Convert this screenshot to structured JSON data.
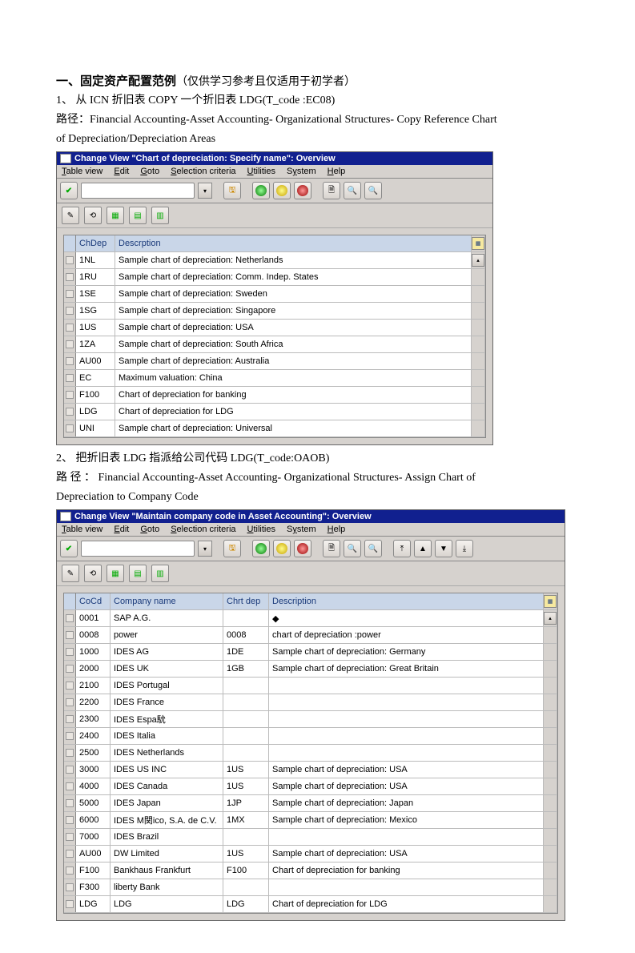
{
  "doc": {
    "title_bold": "一、固定资产配置范例",
    "title_paren": "（仅供学习参考且仅适用于初学者）",
    "step1": "1、 从 ICN 折旧表 COPY 一个折旧表 LDG(T_code :EC08)",
    "path1a": "路径：Financial Accounting-Asset Accounting- Organizational Structures- Copy Reference Chart",
    "path1b": "of Depreciation/Depreciation Areas",
    "step2": "2、 把折旧表 LDG 指派给公司代码 LDG(T_code:OAOB)",
    "path2a": "路 径 ： Financial Accounting-Asset Accounting- Organizational Structures- Assign Chart of",
    "path2b": "Depreciation to Company Code"
  },
  "sap1": {
    "title": "Change View \"Chart of depreciation: Specify name\": Overview",
    "menu": [
      "Table view",
      "Edit",
      "Goto",
      "Selection criteria",
      "Utilities",
      "System",
      "Help"
    ],
    "cols": {
      "code": "ChDep",
      "desc": "Descrption"
    },
    "rows": [
      {
        "code": "1NL",
        "desc": "Sample chart of depreciation: Netherlands"
      },
      {
        "code": "1RU",
        "desc": "Sample chart of depreciation: Comm. Indep. States"
      },
      {
        "code": "1SE",
        "desc": "Sample chart of depreciation: Sweden"
      },
      {
        "code": "1SG",
        "desc": "Sample chart of depreciation: Singapore"
      },
      {
        "code": "1US",
        "desc": "Sample chart of depreciation: USA"
      },
      {
        "code": "1ZA",
        "desc": "Sample chart of depreciation: South Africa"
      },
      {
        "code": "AU00",
        "desc": "Sample chart of depreciation: Australia"
      },
      {
        "code": "EC",
        "desc": "Maximum valuation: China"
      },
      {
        "code": "F100",
        "desc": "Chart of depreciation for banking"
      },
      {
        "code": "LDG",
        "desc": "Chart of depreciation for LDG"
      },
      {
        "code": "UNI",
        "desc": "Sample chart of depreciation: Universal"
      }
    ]
  },
  "sap2": {
    "title": "Change View \"Maintain company code in Asset Accounting\": Overview",
    "menu": [
      "Table view",
      "Edit",
      "Goto",
      "Selection criteria",
      "Utilities",
      "System",
      "Help"
    ],
    "cols": {
      "code": "CoCd",
      "name": "Company name",
      "dep": "Chrt dep",
      "desc": "Description"
    },
    "rows": [
      {
        "code": "0001",
        "name": "SAP A.G.",
        "dep": "",
        "desc": "◆"
      },
      {
        "code": "0008",
        "name": "power",
        "dep": "0008",
        "desc": "chart of depreciation :power"
      },
      {
        "code": "1000",
        "name": "IDES AG",
        "dep": "1DE",
        "desc": "Sample chart of depreciation: Germany"
      },
      {
        "code": "2000",
        "name": "IDES UK",
        "dep": "1GB",
        "desc": "Sample chart of depreciation: Great Britain"
      },
      {
        "code": "2100",
        "name": "IDES Portugal",
        "dep": "",
        "desc": ""
      },
      {
        "code": "2200",
        "name": "IDES France",
        "dep": "",
        "desc": ""
      },
      {
        "code": "2300",
        "name": "IDES Espa馻",
        "dep": "",
        "desc": ""
      },
      {
        "code": "2400",
        "name": "IDES Italia",
        "dep": "",
        "desc": ""
      },
      {
        "code": "2500",
        "name": "IDES Netherlands",
        "dep": "",
        "desc": ""
      },
      {
        "code": "3000",
        "name": "IDES US INC",
        "dep": "1US",
        "desc": "Sample chart of depreciation: USA"
      },
      {
        "code": "4000",
        "name": "IDES Canada",
        "dep": "1US",
        "desc": "Sample chart of depreciation: USA"
      },
      {
        "code": "5000",
        "name": "IDES Japan",
        "dep": "1JP",
        "desc": "Sample chart of depreciation: Japan"
      },
      {
        "code": "6000",
        "name": "IDES M関ico, S.A. de C.V.",
        "dep": "1MX",
        "desc": "Sample chart of depreciation: Mexico"
      },
      {
        "code": "7000",
        "name": "IDES Brazil",
        "dep": "",
        "desc": ""
      },
      {
        "code": "AU00",
        "name": "DW Limited",
        "dep": "1US",
        "desc": "Sample chart of depreciation: USA"
      },
      {
        "code": "F100",
        "name": "Bankhaus Frankfurt",
        "dep": "F100",
        "desc": "Chart of depreciation for banking"
      },
      {
        "code": "F300",
        "name": "liberty Bank",
        "dep": "",
        "desc": ""
      },
      {
        "code": "LDG",
        "name": "LDG",
        "dep": "LDG",
        "desc": "Chart of depreciation for LDG"
      }
    ]
  }
}
